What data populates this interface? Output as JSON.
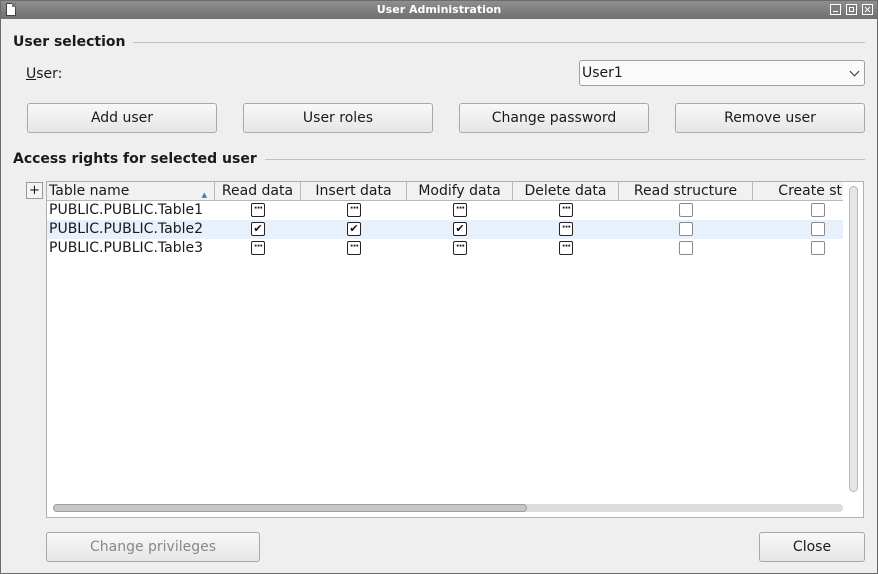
{
  "window": {
    "title": "User Administration"
  },
  "user_selection": {
    "section_title": "User selection",
    "user_label": "User:",
    "user_value": "User1",
    "buttons": {
      "add_user": "Add user",
      "user_roles": "User roles",
      "change_password": "Change password",
      "remove_user": "Remove user"
    }
  },
  "access_rights": {
    "section_title": "Access rights for selected user",
    "plus_label": "+",
    "columns": [
      "Table name",
      "Read data",
      "Insert data",
      "Modify data",
      "Delete data",
      "Read structure",
      "Create stru"
    ],
    "rows": [
      {
        "name": "PUBLIC.PUBLIC.Table1",
        "states": [
          "partial",
          "partial",
          "partial",
          "partial",
          "empty",
          "empty"
        ]
      },
      {
        "name": "PUBLIC.PUBLIC.Table2",
        "states": [
          "checked",
          "checked",
          "checked",
          "partial",
          "empty",
          "empty"
        ]
      },
      {
        "name": "PUBLIC.PUBLIC.Table3",
        "states": [
          "partial",
          "partial",
          "partial",
          "partial",
          "empty",
          "empty"
        ]
      }
    ]
  },
  "footer": {
    "change_privileges": "Change privileges",
    "close": "Close"
  }
}
